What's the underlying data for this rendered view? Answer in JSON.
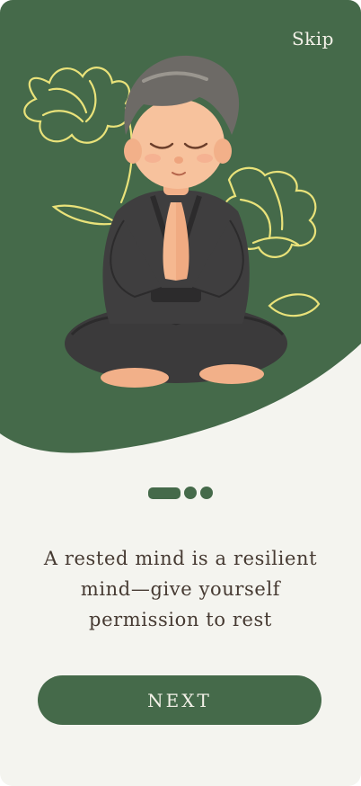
{
  "colors": {
    "brand_green": "#456a4a",
    "background": "#f4f4ef",
    "text_dark": "#463a32",
    "text_light": "#f3f1e8",
    "flower_outline": "#e9e27a"
  },
  "onboarding": {
    "skip_label": "Skip",
    "illustration_icon": "meditating-child-illustration",
    "page_indicator": {
      "current": 1,
      "total": 3
    },
    "headline": "A rested mind is a resilient mind—give yourself permission to rest",
    "next_label": "NEXT"
  }
}
